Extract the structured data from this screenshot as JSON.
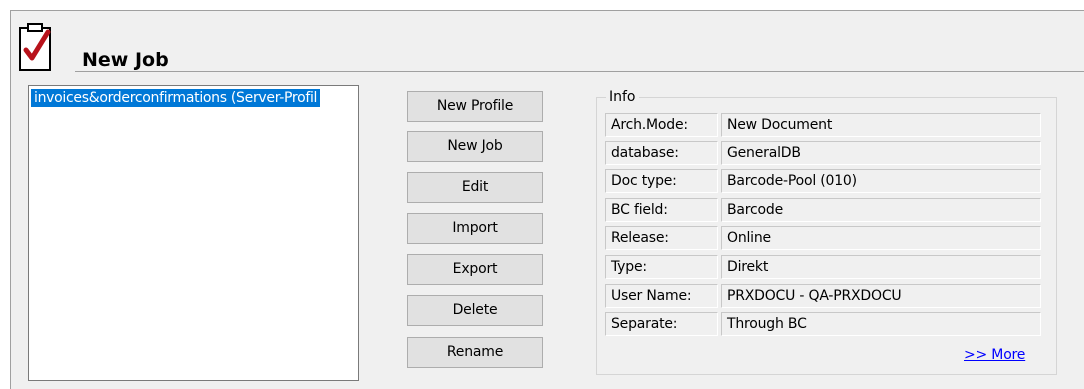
{
  "header": {
    "title": "New Job",
    "icon": "clipboard-check-icon"
  },
  "job_list": {
    "items": [
      {
        "label": "invoices&orderconfirmations (Server-Profil",
        "selected": true
      }
    ]
  },
  "buttons": {
    "new_profile": "New Profile",
    "new_job": "New Job",
    "edit": "Edit",
    "import": "Import",
    "export": "Export",
    "delete": "Delete",
    "rename": "Rename"
  },
  "info": {
    "title": "Info",
    "rows": [
      {
        "label": "Arch.Mode:",
        "value": "New Document"
      },
      {
        "label": "database:",
        "value": "GeneralDB"
      },
      {
        "label": "Doc type:",
        "value": "Barcode-Pool (010)"
      },
      {
        "label": "BC field:",
        "value": "Barcode"
      },
      {
        "label": "Release:",
        "value": "Online"
      },
      {
        "label": "Type:",
        "value": "Direkt"
      },
      {
        "label": "User Name:",
        "value": "PRXDOCU - QA-PRXDOCU"
      },
      {
        "label": "Separate:",
        "value": "Through BC"
      }
    ],
    "more_link": ">> More"
  },
  "colors": {
    "panel_background": "#f0f0f0",
    "selection": "#0078d7",
    "link": "#0000ff",
    "check_mark": "#b8121b"
  }
}
